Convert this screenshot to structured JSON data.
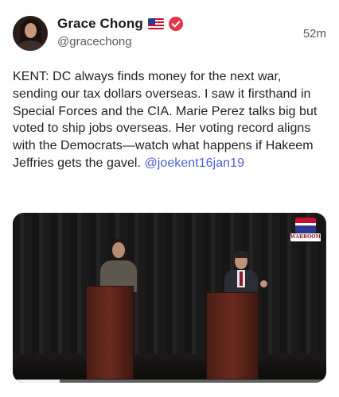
{
  "post": {
    "author": {
      "display_name": "Grace Chong",
      "handle": "@gracechong",
      "flag_icon": "us-flag-icon",
      "verified_icon": "verified-badge-icon",
      "verified_color": "#e3364a"
    },
    "timestamp": "52m",
    "text": "KENT: DC always finds money for the next war, sending our tax dollars overseas. I saw it firsthand in Special Forces and the CIA. Marie Perez talks big but voted to ship jobs overseas. Her voting record aligns with the Democrats—watch what happens if Hakeem Jeffries gets the gavel.",
    "mention": "@joekent16jan19",
    "mention_color": "#4b5fd6",
    "media": {
      "watermark": "WARROOM",
      "progress": 0.15
    }
  }
}
